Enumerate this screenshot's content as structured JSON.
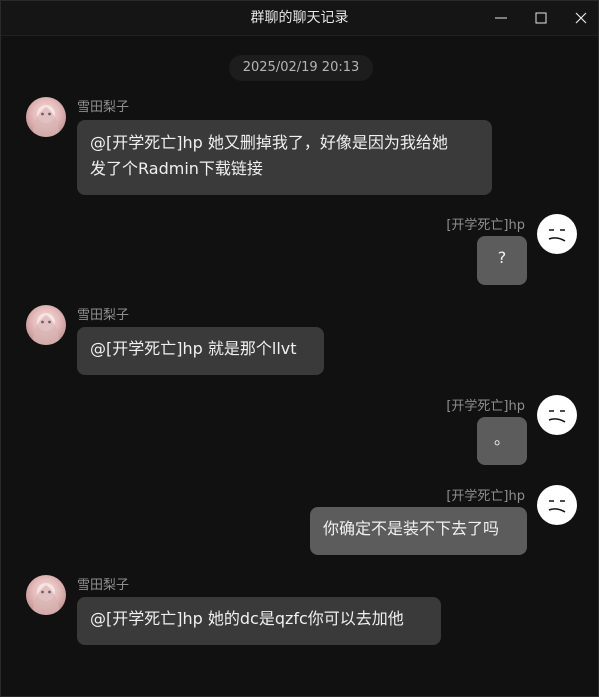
{
  "window": {
    "title": "群聊的聊天记录"
  },
  "timestamp": "2025/02/19 20:13",
  "messages": [
    {
      "sender": "雪田梨子",
      "side": "left",
      "lines": [
        "@[开学死亡]hp 她又删掉我了，好像是因为我给她",
        "发了个Radmin下载链接"
      ]
    },
    {
      "sender": "[开学死亡]hp",
      "side": "right",
      "text": "?"
    },
    {
      "sender": "雪田梨子",
      "side": "left",
      "text": "@[开学死亡]hp 就是那个llvt"
    },
    {
      "sender": "[开学死亡]hp",
      "side": "right",
      "text": "。"
    },
    {
      "sender": "[开学死亡]hp",
      "side": "right",
      "text": "你确定不是装不下去了吗"
    },
    {
      "sender": "雪田梨子",
      "side": "left",
      "text": "@[开学死亡]hp 她的dc是qzfc你可以去加他"
    }
  ],
  "icons": {
    "minimize": "minimize-icon",
    "maximize": "maximize-icon",
    "close": "close-icon",
    "avatar_left": "anime-girl-avatar",
    "avatar_right": "meh-face-avatar"
  },
  "colors": {
    "background": "#111111",
    "bubble": "#3a3a3a",
    "bubble_self": "#5c5c5c",
    "name": "#8f8f8f"
  }
}
